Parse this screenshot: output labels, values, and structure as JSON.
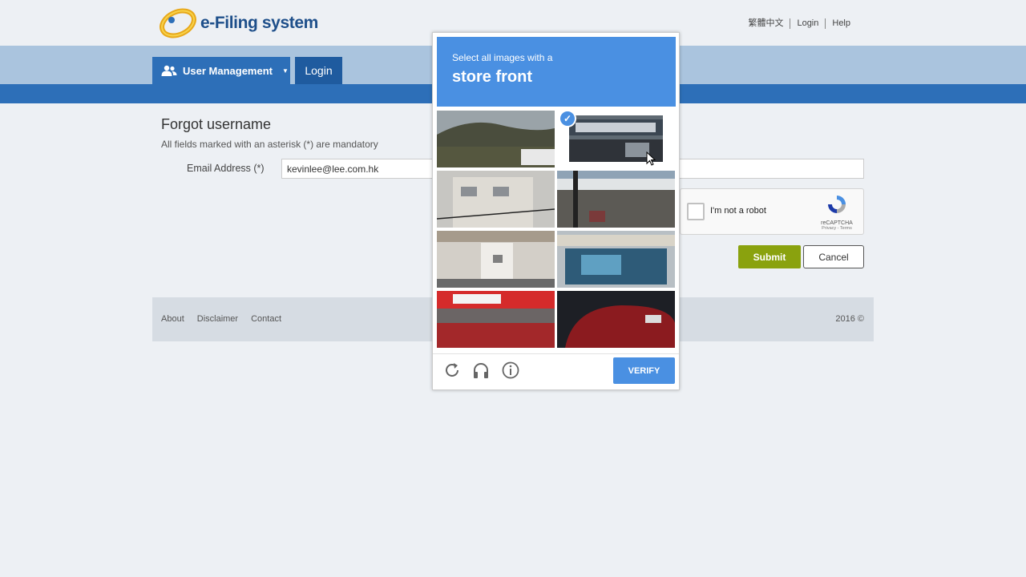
{
  "header": {
    "logo_text": "e-Filing system",
    "links": [
      "繁體中文",
      "Login",
      "Help"
    ]
  },
  "nav": {
    "user_management": "User Management",
    "login": "Login"
  },
  "form": {
    "title": "Forgot username",
    "mandatory_note": "All fields marked with an asterisk (*) are mandatory",
    "email_label": "Email Address (*)",
    "email_value": "kevinlee@lee.com.hk",
    "submit": "Submit",
    "cancel": "Cancel"
  },
  "recaptcha": {
    "checkbox_text": "I'm not a robot",
    "brand": "reCAPTCHA",
    "privacy": "Privacy - Terms"
  },
  "captcha_popup": {
    "instruction": "Select all images with a",
    "target": "store front",
    "verify": "VERIFY",
    "selected_tile": 2,
    "icons": [
      "reload-icon",
      "audio-icon",
      "info-icon"
    ]
  },
  "footer": {
    "links": [
      "About",
      "Disclaimer",
      "Contact"
    ],
    "year": "2016 ©"
  },
  "colors": {
    "brand_blue": "#2d6fb8",
    "nav_band": "#aac4de",
    "submit_green": "#8aa20e",
    "captcha_blue": "#4a90e2"
  }
}
